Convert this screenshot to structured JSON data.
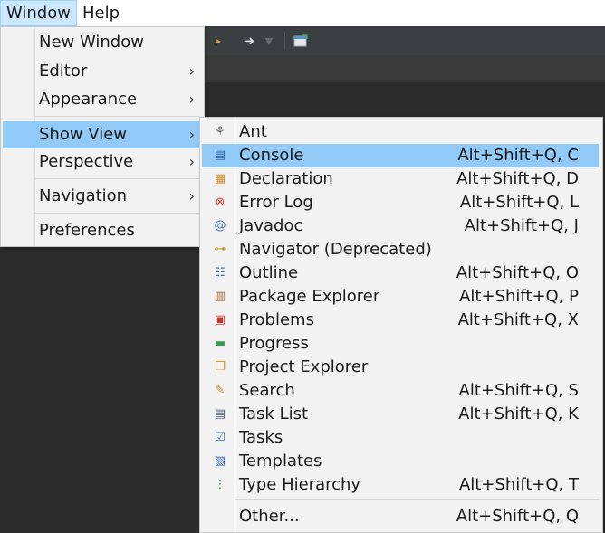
{
  "menubar": {
    "window": "Window",
    "help": "Help"
  },
  "toolbar": {
    "icons": [
      "arrow-right-icon",
      "chevron-down-icon",
      "new-window-icon"
    ]
  },
  "window_menu": {
    "items": [
      {
        "label": "New Window",
        "submenu": false
      },
      {
        "label": "Editor",
        "submenu": true
      },
      {
        "label": "Appearance",
        "submenu": true
      },
      {
        "label": "Show View",
        "submenu": true,
        "highlighted": true
      },
      {
        "label": "Perspective",
        "submenu": true
      },
      {
        "label": "Navigation",
        "submenu": true
      },
      {
        "label": "Preferences",
        "submenu": false
      }
    ],
    "arrow": "›"
  },
  "show_view_menu": {
    "items": [
      {
        "label": "Ant",
        "shortcut": "",
        "icon": "ant-icon",
        "glyph": "⚘",
        "color": "#6b6b6b"
      },
      {
        "label": "Console",
        "shortcut": "Alt+Shift+Q, C",
        "icon": "console-icon",
        "glyph": "▤",
        "color": "#2f5d9e",
        "highlighted": true
      },
      {
        "label": "Declaration",
        "shortcut": "Alt+Shift+Q, D",
        "icon": "declaration-icon",
        "glyph": "▦",
        "color": "#c88a2a"
      },
      {
        "label": "Error Log",
        "shortcut": "Alt+Shift+Q, L",
        "icon": "error-log-icon",
        "glyph": "⊗",
        "color": "#d23a2a"
      },
      {
        "label": "Javadoc",
        "shortcut": "Alt+Shift+Q, J",
        "icon": "javadoc-icon",
        "glyph": "@",
        "color": "#3b6fb6"
      },
      {
        "label": "Navigator (Deprecated)",
        "shortcut": "",
        "icon": "navigator-icon",
        "glyph": "⊶",
        "color": "#c8962a"
      },
      {
        "label": "Outline",
        "shortcut": "Alt+Shift+Q, O",
        "icon": "outline-icon",
        "glyph": "☷",
        "color": "#3b6fb6"
      },
      {
        "label": "Package Explorer",
        "shortcut": "Alt+Shift+Q, P",
        "icon": "package-explorer-icon",
        "glyph": "▥",
        "color": "#9a6a3a"
      },
      {
        "label": "Problems",
        "shortcut": "Alt+Shift+Q, X",
        "icon": "problems-icon",
        "glyph": "▣",
        "color": "#c0392b"
      },
      {
        "label": "Progress",
        "shortcut": "",
        "icon": "progress-icon",
        "glyph": "▬",
        "color": "#3a9a4a"
      },
      {
        "label": "Project Explorer",
        "shortcut": "",
        "icon": "project-explorer-icon",
        "glyph": "❐",
        "color": "#d4a02a"
      },
      {
        "label": "Search",
        "shortcut": "Alt+Shift+Q, S",
        "icon": "search-icon",
        "glyph": "✎",
        "color": "#c8962a"
      },
      {
        "label": "Task List",
        "shortcut": "Alt+Shift+Q, K",
        "icon": "task-list-icon",
        "glyph": "▤",
        "color": "#4a5a7a"
      },
      {
        "label": "Tasks",
        "shortcut": "",
        "icon": "tasks-icon",
        "glyph": "☑",
        "color": "#3b6fb6"
      },
      {
        "label": "Templates",
        "shortcut": "",
        "icon": "templates-icon",
        "glyph": "▧",
        "color": "#3b6fb6"
      },
      {
        "label": "Type Hierarchy",
        "shortcut": "Alt+Shift+Q, T",
        "icon": "type-hierarchy-icon",
        "glyph": "⋮",
        "color": "#2f8a4a"
      },
      {
        "label": "Other...",
        "shortcut": "Alt+Shift+Q, Q",
        "icon": "",
        "glyph": "",
        "color": ""
      }
    ]
  }
}
